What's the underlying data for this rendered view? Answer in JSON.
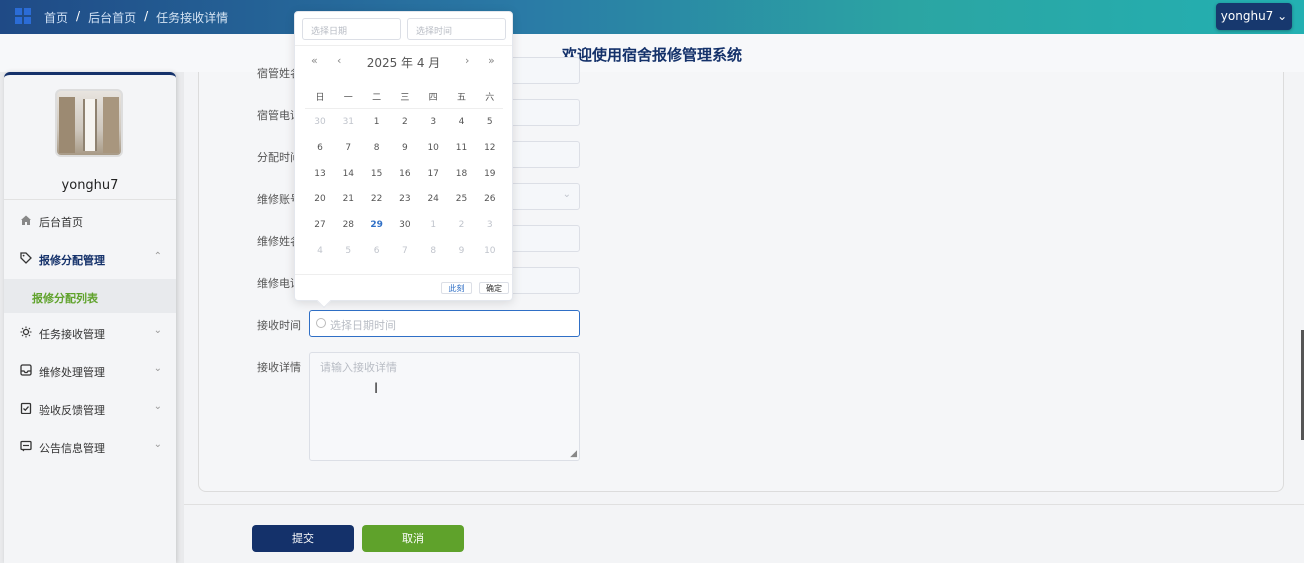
{
  "topbar": {
    "breadcrumbs": [
      "首页",
      "后台首页",
      "任务接收详情"
    ],
    "user_button": "yonghu7"
  },
  "header": {
    "title": "欢迎使用宿舍报修管理系统"
  },
  "sidebar": {
    "username": "yonghu7",
    "items": [
      {
        "label": "后台首页"
      },
      {
        "label": "报修分配管理"
      },
      {
        "label": "报修分配列表"
      },
      {
        "label": "任务接收管理"
      },
      {
        "label": "维修处理管理"
      },
      {
        "label": "验收反馈管理"
      },
      {
        "label": "公告信息管理"
      }
    ]
  },
  "form": {
    "labels": {
      "dorm_name": "宿管姓名",
      "dorm_phone": "宿管电话",
      "assign_time": "分配时间",
      "repair_account": "维修账号",
      "repair_name": "维修姓名",
      "repair_phone": "维修电话",
      "receive_time": "接收时间",
      "receive_detail": "接收详情"
    },
    "receive_time_placeholder": "选择日期时间",
    "receive_detail_placeholder": "请输入接收详情",
    "submit": "提交",
    "cancel": "取消"
  },
  "datepicker": {
    "date_placeholder": "选择日期",
    "time_placeholder": "选择时间",
    "year_month": "2025 年  4 月",
    "weekdays": [
      "日",
      "一",
      "二",
      "三",
      "四",
      "五",
      "六"
    ],
    "weeks": [
      [
        "30",
        "31",
        "1",
        "2",
        "3",
        "4",
        "5"
      ],
      [
        "6",
        "7",
        "8",
        "9",
        "10",
        "11",
        "12"
      ],
      [
        "13",
        "14",
        "15",
        "16",
        "17",
        "18",
        "19"
      ],
      [
        "20",
        "21",
        "22",
        "23",
        "24",
        "25",
        "26"
      ],
      [
        "27",
        "28",
        "29",
        "30",
        "1",
        "2",
        "3"
      ],
      [
        "4",
        "5",
        "6",
        "7",
        "8",
        "9",
        "10"
      ]
    ],
    "today": "29",
    "now_button": "此刻",
    "ok_button": "确定"
  }
}
